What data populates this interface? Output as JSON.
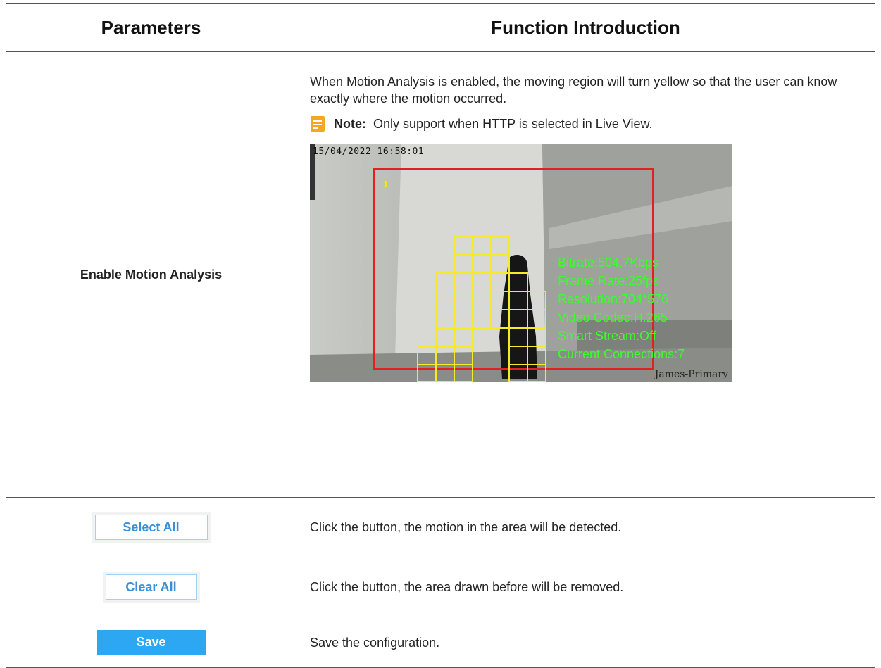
{
  "headers": {
    "parameters": "Parameters",
    "function": "Function Introduction"
  },
  "motion": {
    "param": "Enable Motion Analysis",
    "description": "When Motion Analysis is enabled, the moving region will turn yellow so that the user can know exactly where the motion occurred.",
    "note_label": "Note:",
    "note_text": "Only support when HTTP is selected in Live View.",
    "note_icon": "note-icon",
    "note_icon_color": "#f5a623",
    "camera": {
      "osd_datetime": "15/04/2022 16:58:01",
      "zone_number": "1",
      "channel_label": "James-Primary",
      "zone_color": "#e41f1f",
      "grid_color": "#f3ea2c",
      "stats_color": "#39ff2b",
      "stats": [
        "Bitrate:504.7Kbps",
        "Frame Rate:25fps",
        "Resolution:704*576",
        "Video Codec:H.265",
        "Smart Stream:Off",
        "Current Connections:7"
      ]
    }
  },
  "select_all": {
    "button_label": "Select All",
    "description": "Click the button, the motion in the area will be detected."
  },
  "clear_all": {
    "button_label": "Clear All",
    "description": "Click the button, the area drawn before will be removed."
  },
  "save": {
    "button_label": "Save",
    "description": "Save the configuration.",
    "button_color": "#2ea7f2"
  }
}
